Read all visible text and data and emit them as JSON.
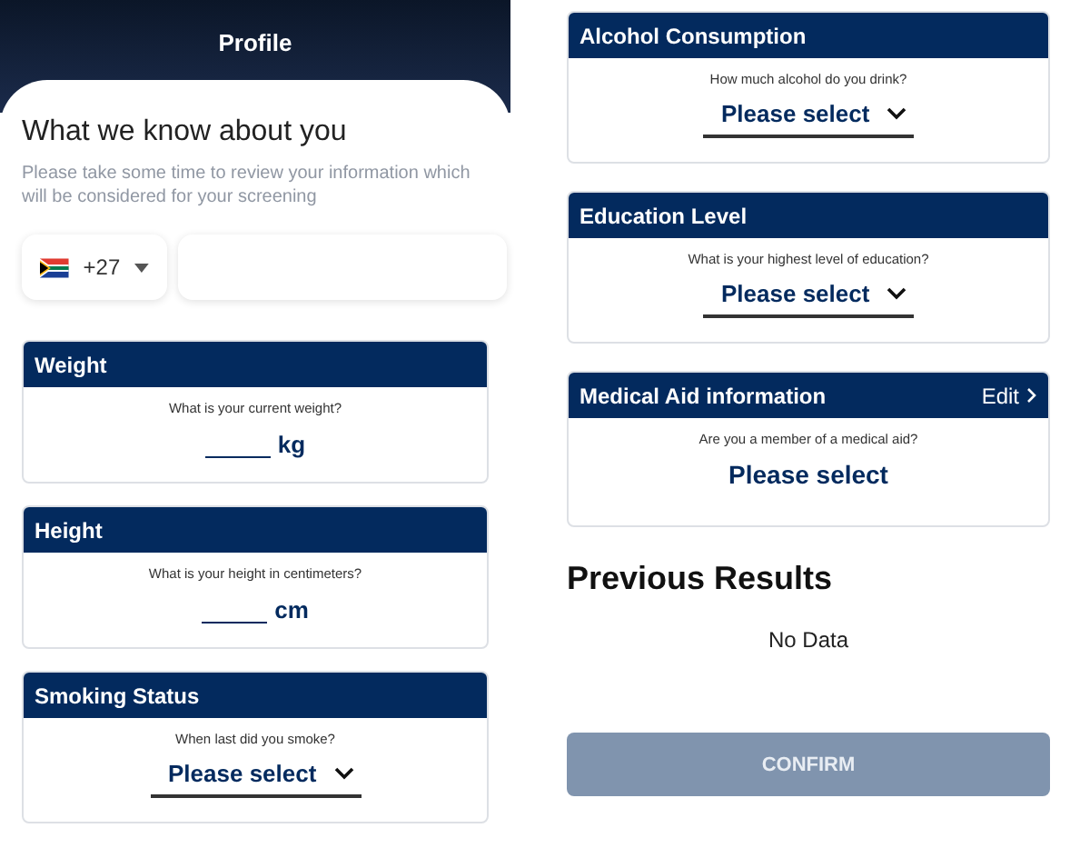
{
  "header": {
    "title": "Profile"
  },
  "intro": {
    "title": "What we know about you",
    "subtitle": "Please take some time to review your information which will be considered for your screening"
  },
  "phone": {
    "code": "+27"
  },
  "cards_left": [
    {
      "title": "Weight",
      "question": "What is your current weight?",
      "kind": "unit",
      "unit": "kg"
    },
    {
      "title": "Height",
      "question": "What is your height in centimeters?",
      "kind": "unit",
      "unit": "cm"
    },
    {
      "title": "Smoking Status",
      "question": "When last did you smoke?",
      "kind": "select",
      "value": "Please select"
    }
  ],
  "cards_right": [
    {
      "title": "Alcohol Consumption",
      "question": "How much alcohol do you drink?",
      "kind": "select",
      "value": "Please select"
    },
    {
      "title": "Education Level",
      "question": "What is your highest level of education?",
      "kind": "select",
      "value": "Please select"
    },
    {
      "title": "Medical Aid information",
      "action": "Edit",
      "question": "Are you a member of a medical aid?",
      "kind": "plain",
      "value": "Please select"
    }
  ],
  "previous_results": {
    "title": "Previous Results",
    "empty_text": "No Data"
  },
  "confirm_button": {
    "label": "CONFIRM",
    "disabled": true
  }
}
